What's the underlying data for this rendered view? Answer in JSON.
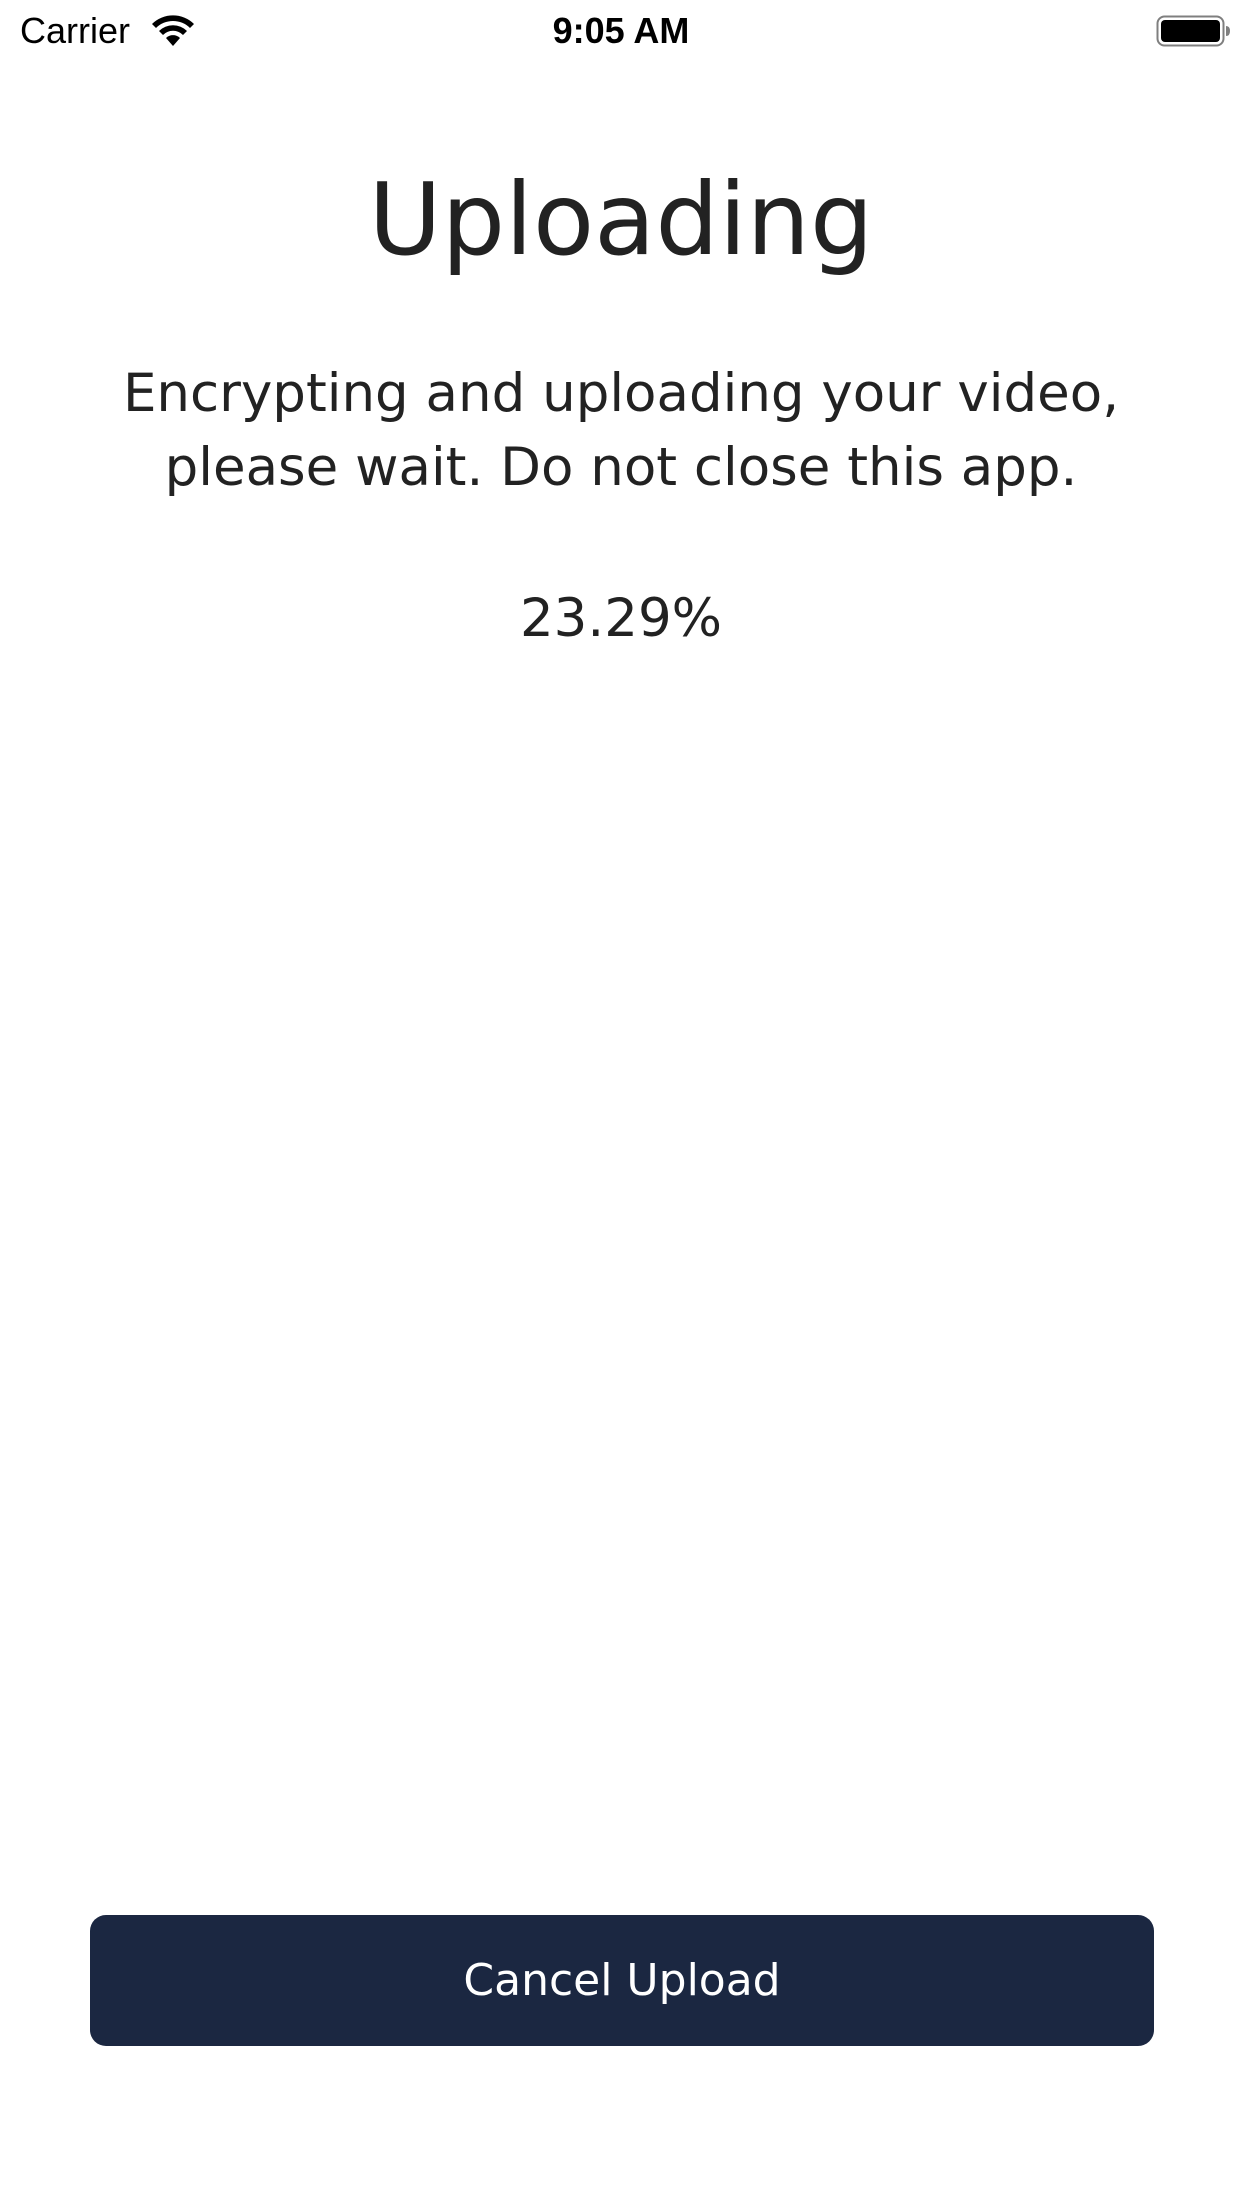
{
  "status_bar": {
    "carrier": "Carrier",
    "time": "9:05 AM",
    "wifi_icon": "wifi-icon",
    "battery_icon": "battery-full-icon"
  },
  "upload": {
    "title": "Uploading",
    "message": "Encrypting and uploading your video, please wait. Do not close this app.",
    "progress_text": "23.29%",
    "cancel_label": "Cancel Upload"
  },
  "colors": {
    "button_background": "#1b2741",
    "button_text": "#ffffff",
    "text": "#222222",
    "background": "#ffffff"
  }
}
